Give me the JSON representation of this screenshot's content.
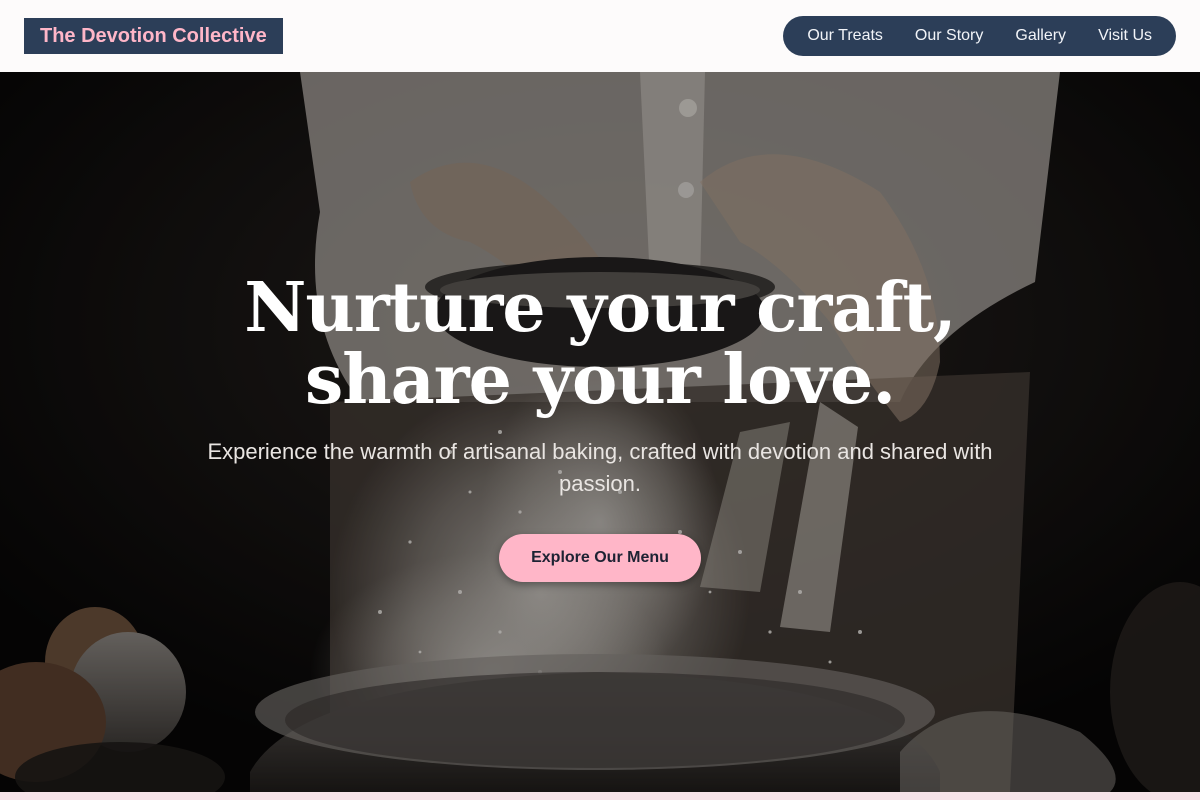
{
  "header": {
    "brand": "The Devotion Collective",
    "nav": [
      {
        "label": "Our Treats"
      },
      {
        "label": "Our Story"
      },
      {
        "label": "Gallery"
      },
      {
        "label": "Visit Us"
      }
    ]
  },
  "hero": {
    "title": "Nurture your craft, share your love.",
    "subtitle": "Experience the warmth of artisanal baking, crafted with devotion and shared with passion.",
    "cta_label": "Explore Our Menu",
    "background_image": "baker sifting flour into a bowl"
  },
  "colors": {
    "header_bg": "#fdfbfb",
    "brand_bg": "#2c3e58",
    "brand_text": "#ffb6c8",
    "nav_bg": "#2c3e58",
    "nav_text": "#f2f4f8",
    "cta_bg": "#ffb6c8",
    "cta_text": "#1d2233",
    "hero_title": "#ffffff"
  }
}
